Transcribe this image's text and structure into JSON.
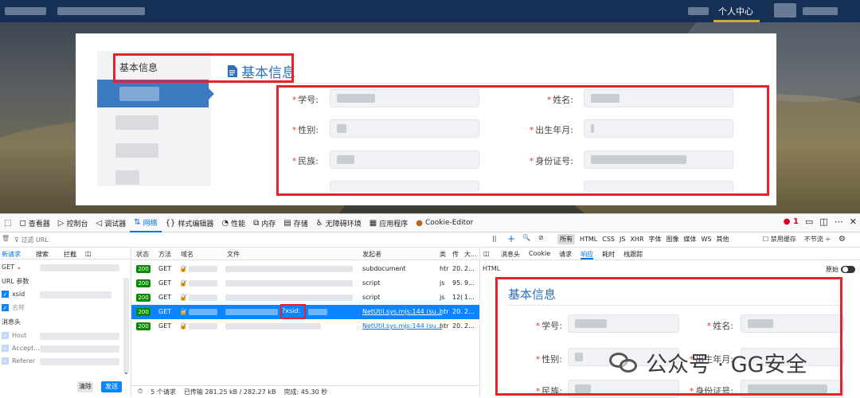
{
  "nav": {
    "user_center": "个人中心"
  },
  "sidebar": {
    "title": "基本信息"
  },
  "info": {
    "title": "基本信息",
    "fields": [
      {
        "label": "学号:"
      },
      {
        "label": "姓名:"
      },
      {
        "label": "性别:"
      },
      {
        "label": "出生年月:"
      },
      {
        "label": "民族:"
      },
      {
        "label": "身份证号:"
      }
    ]
  },
  "devtools": {
    "tabs": [
      {
        "icon": "inspector-icon",
        "label": "查看器"
      },
      {
        "icon": "console-icon",
        "label": "控制台"
      },
      {
        "icon": "debugger-icon",
        "label": "调试器"
      },
      {
        "icon": "network-icon",
        "label": "网络"
      },
      {
        "icon": "style-editor-icon",
        "label": "样式编辑器"
      },
      {
        "icon": "performance-icon",
        "label": "性能"
      },
      {
        "icon": "memory-icon",
        "label": "内存"
      },
      {
        "icon": "storage-icon",
        "label": "存储"
      },
      {
        "icon": "accessibility-icon",
        "label": "无障碍环境"
      },
      {
        "icon": "application-icon",
        "label": "应用程序"
      },
      {
        "icon": "cookie-editor-icon",
        "label": "Cookie-Editor"
      }
    ],
    "active_tab": "网络",
    "error_count": "1",
    "filter_placeholder": "过滤 URL",
    "type_filters": [
      "所有",
      "HTML",
      "CSS",
      "JS",
      "XHR",
      "字体",
      "图像",
      "媒体",
      "WS",
      "其他"
    ],
    "disable_cache": "禁用缓存",
    "throttle": "不节流 ÷",
    "left_pane": {
      "tabs": [
        "新请求",
        "搜索",
        "拦截"
      ],
      "method": "GET",
      "url_params_title": "URL 参数",
      "param_name": "xsid",
      "param_placeholder": "名称",
      "headers_title": "消息头",
      "headers": [
        "Host",
        "Accept...",
        "Referer"
      ],
      "clear_label": "清除",
      "send_label": "发送"
    },
    "table": {
      "headers": [
        "状态",
        "方法",
        "域名",
        "文件",
        "发起者",
        "类",
        "传",
        "大..."
      ],
      "rows": [
        {
          "status": "200",
          "method": "GET",
          "initiator": "subdocument",
          "type": "htr",
          "transferred": "20.",
          "size": "2..."
        },
        {
          "status": "200",
          "method": "GET",
          "initiator": "script",
          "type": "js",
          "transferred": "95.",
          "size": "9..."
        },
        {
          "status": "200",
          "method": "GET",
          "initiator": "script",
          "type": "js",
          "transferred": "12(",
          "size": "1..."
        },
        {
          "status": "200",
          "method": "GET",
          "file_tag": "?xsid:",
          "initiator": "NetUtil.sys.mjs:144 (su...",
          "type": "htr",
          "transferred": "20.",
          "size": "2..."
        },
        {
          "status": "200",
          "method": "GET",
          "initiator": "NetUtil.sys.mjs:144 (su...",
          "type": "htr",
          "transferred": "20.",
          "size": "2..."
        }
      ],
      "footer": {
        "requests": "5 个请求",
        "transferred": "已传输 281.25 kB / 282.27 kB",
        "finish": "完成: 45.30 秒"
      }
    },
    "response": {
      "tabs": [
        "消息头",
        "Cookie",
        "请求",
        "响应",
        "耗时",
        "栈跟踪"
      ],
      "active": "响应",
      "format": "HTML",
      "raw_label": "原始",
      "preview_title": "基本信息",
      "preview_fields": [
        {
          "label": "学号:"
        },
        {
          "label": "姓名:"
        },
        {
          "label": "性别:"
        },
        {
          "label": "出生年月:"
        },
        {
          "label": "民族:"
        },
        {
          "label": "身份证号:"
        }
      ]
    }
  },
  "watermark": {
    "text": "公众号 · GG安全"
  },
  "colors": {
    "highlight": "#e5232b",
    "primary": "#2e6fbd",
    "accent": "#0a84ff"
  }
}
